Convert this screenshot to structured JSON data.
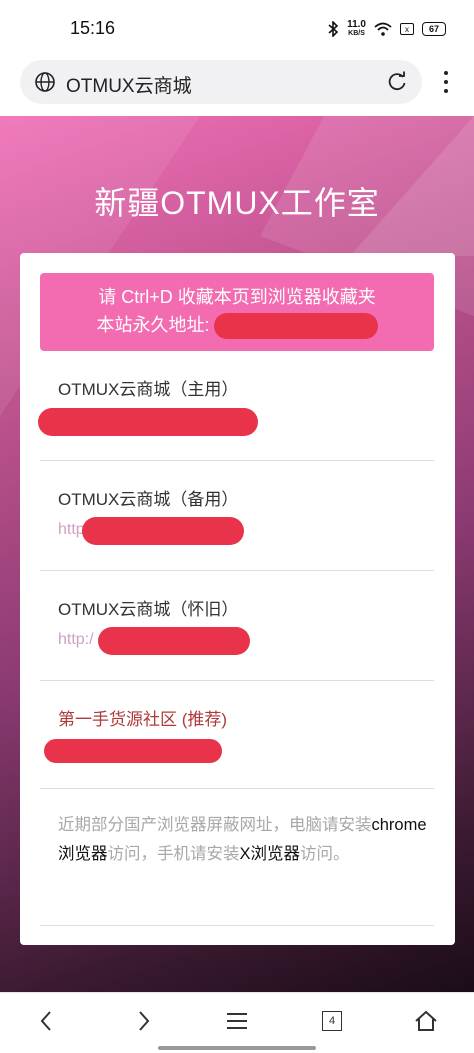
{
  "status": {
    "time": "15:16",
    "net_speed": "11.0",
    "net_unit": "KB/S",
    "battery": "67",
    "sim": "x"
  },
  "browser": {
    "address_title": "OTMUX云商城",
    "tab_count": "4"
  },
  "page": {
    "title": "新疆OTMUX工作室",
    "bookmark_line1": "请 Ctrl+D 收藏本页到浏览器收藏夹",
    "bookmark_line2": "本站永久地址:",
    "links": [
      {
        "label": "OTMUX云商城（主用）",
        "url_prefix": ""
      },
      {
        "label": "OTMUX云商城（备用）",
        "url_prefix": "http"
      },
      {
        "label": "OTMUX云商城（怀旧）",
        "url_prefix": "http:/"
      },
      {
        "label": "第一手货源社区 (推荐)",
        "url_prefix": ""
      }
    ],
    "notice_part1": "近期部分国产浏览器屏蔽网址，电脑请安装",
    "notice_bold1": "chrome浏览器",
    "notice_part2": "访问，手机请安装",
    "notice_bold2": "X浏览器",
    "notice_part3": "访问。"
  },
  "colors": {
    "tip_bg": "#f36cb1",
    "redaction": "#e8334a",
    "recommend_label": "#b03a3a"
  }
}
